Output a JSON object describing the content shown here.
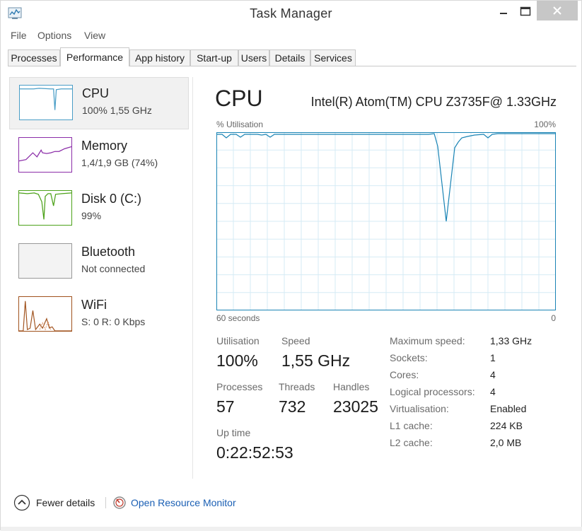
{
  "window": {
    "title": "Task Manager",
    "app_icon": "task-manager-icon",
    "controls": {
      "minimize": "minimize-icon",
      "maximize": "maximize-icon",
      "close": "close-icon"
    }
  },
  "menu": [
    {
      "label": "File"
    },
    {
      "label": "Options"
    },
    {
      "label": "View"
    }
  ],
  "tabs": [
    {
      "label": "Processes"
    },
    {
      "label": "Performance",
      "active": true
    },
    {
      "label": "App history"
    },
    {
      "label": "Start-up"
    },
    {
      "label": "Users"
    },
    {
      "label": "Details"
    },
    {
      "label": "Services"
    }
  ],
  "sidebar": [
    {
      "title": "CPU",
      "sub": "100%  1,55 GHz",
      "color": "#4a9ec7",
      "active": true
    },
    {
      "title": "Memory",
      "sub": "1,4/1,9 GB (74%)",
      "color": "#8b2da8"
    },
    {
      "title": "Disk 0 (C:)",
      "sub": "99%",
      "color": "#4da21a"
    },
    {
      "title": "Bluetooth",
      "sub": "Not connected",
      "color": "#999999"
    },
    {
      "title": "WiFi",
      "sub": "S: 0 R: 0 Kbps",
      "color": "#a0521d"
    }
  ],
  "main": {
    "title": "CPU",
    "model": "Intel(R) Atom(TM) CPU Z3735F@ 1.33GHz",
    "graph": {
      "y_label": "% Utilisation",
      "y_max_label": "100%",
      "x_left_label": "60 seconds",
      "x_right_label": "0",
      "line_color": "#1a84b5",
      "grid_color": "#d6ebf5",
      "border_color": "#1a84b5"
    },
    "stats": {
      "utilisation_label": "Utilisation",
      "utilisation": "100%",
      "speed_label": "Speed",
      "speed": "1,55 GHz",
      "processes_label": "Processes",
      "processes": "57",
      "threads_label": "Threads",
      "threads": "732",
      "handles_label": "Handles",
      "handles": "23025",
      "uptime_label": "Up time",
      "uptime": "0:22:52:53"
    },
    "info": [
      {
        "label": "Maximum speed:",
        "value": "1,33 GHz"
      },
      {
        "label": "Sockets:",
        "value": "1"
      },
      {
        "label": "Cores:",
        "value": "4"
      },
      {
        "label": "Logical processors:",
        "value": "4"
      },
      {
        "label": "Virtualisation:",
        "value": "Enabled"
      },
      {
        "label": "L1 cache:",
        "value": "224 KB"
      },
      {
        "label": "L2 cache:",
        "value": "2,0 MB"
      }
    ]
  },
  "footer": {
    "fewer_details": "Fewer details",
    "fewer_icon": "chevron-up-circle-icon",
    "resource_monitor": "Open Resource Monitor",
    "resource_icon": "resource-monitor-icon"
  }
}
